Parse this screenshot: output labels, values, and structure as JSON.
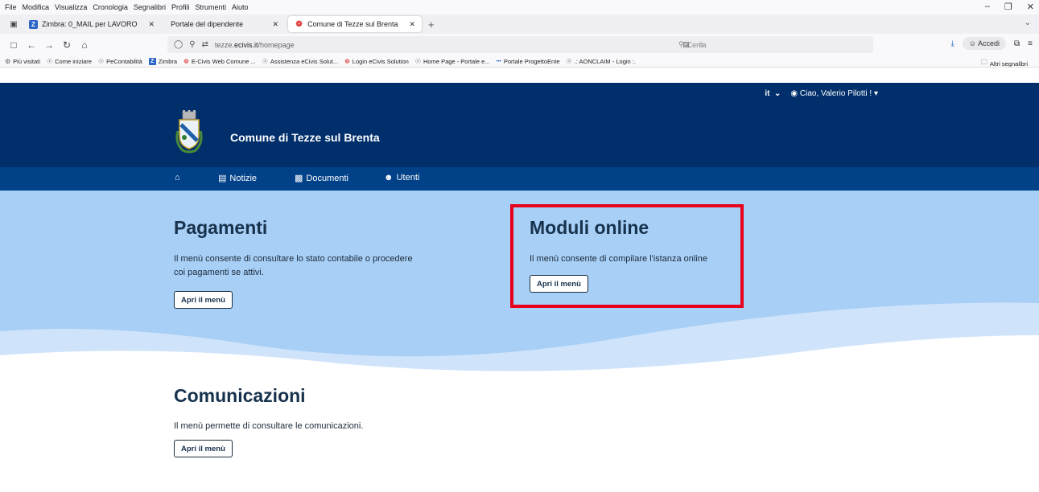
{
  "browser": {
    "menu": [
      "File",
      "Modifica",
      "Visualizza",
      "Cronologia",
      "Segnalibri",
      "Profili",
      "Strumenti",
      "Aiuto"
    ],
    "tabs": [
      {
        "label": "Zimbra: 0_MAIL per LAVORO",
        "icon": "zimbra-icon",
        "active": false
      },
      {
        "label": "Portale del dipendente",
        "icon": "",
        "active": false
      },
      {
        "label": "Comune di Tezze sul Brenta",
        "icon": "ecivis-icon",
        "active": true
      }
    ],
    "url_prefix": "tezze.",
    "url_host": "ecivis.it",
    "url_path": "/homepage",
    "search_placeholder": "Cerca",
    "accedi_label": "Accedi",
    "bookmarks": [
      {
        "label": "Più visitati",
        "icon": "gear"
      },
      {
        "label": "Come iniziare",
        "icon": "globe"
      },
      {
        "label": "PeContabilità",
        "icon": "globe"
      },
      {
        "label": "Zimbra",
        "icon": "zimbra"
      },
      {
        "label": "E-Civis Web Comune ...",
        "icon": "ecivis"
      },
      {
        "label": "Assistenza eCivis Solut...",
        "icon": "globe"
      },
      {
        "label": "Login eCivis Solution",
        "icon": "ecivis"
      },
      {
        "label": "Home Page - Portale e...",
        "icon": "globe"
      },
      {
        "label": "Portale ProgettoEnte",
        "icon": "dots"
      },
      {
        "label": ".: AONCLAIM - Login :.",
        "icon": "globe"
      }
    ],
    "bookmarks_other": "Altri segnalibri"
  },
  "site": {
    "lang": "it",
    "user_greeting": "Ciao, Valerio Pilotti !",
    "name": "Comune di Tezze sul Brenta",
    "nav": [
      {
        "label": "",
        "icon": "home-icon"
      },
      {
        "label": "Notizie",
        "icon": "newspaper-icon"
      },
      {
        "label": "Documenti",
        "icon": "file-icon"
      },
      {
        "label": "Utenti",
        "icon": "users-icon"
      }
    ]
  },
  "cards": [
    {
      "title": "Pagamenti",
      "desc_line1": "Il menù consente di consultare lo stato contabile o procedere",
      "desc_line2": "coi pagamenti se attivi.",
      "button": "Apri il menù"
    },
    {
      "title": "Moduli online",
      "desc_line1": "Il menù consente di compilare l'istanza online",
      "desc_line2": "",
      "button": "Apri il menù"
    },
    {
      "title": "Comunicazioni",
      "desc_line1": "Il menù permette di consultare le comunicazioni.",
      "desc_line2": "",
      "button": "Apri il menù"
    }
  ],
  "colors": {
    "header": "#002f6b",
    "nav": "#004188",
    "hero": "#a8cff6",
    "highlight": "#e8001c"
  }
}
